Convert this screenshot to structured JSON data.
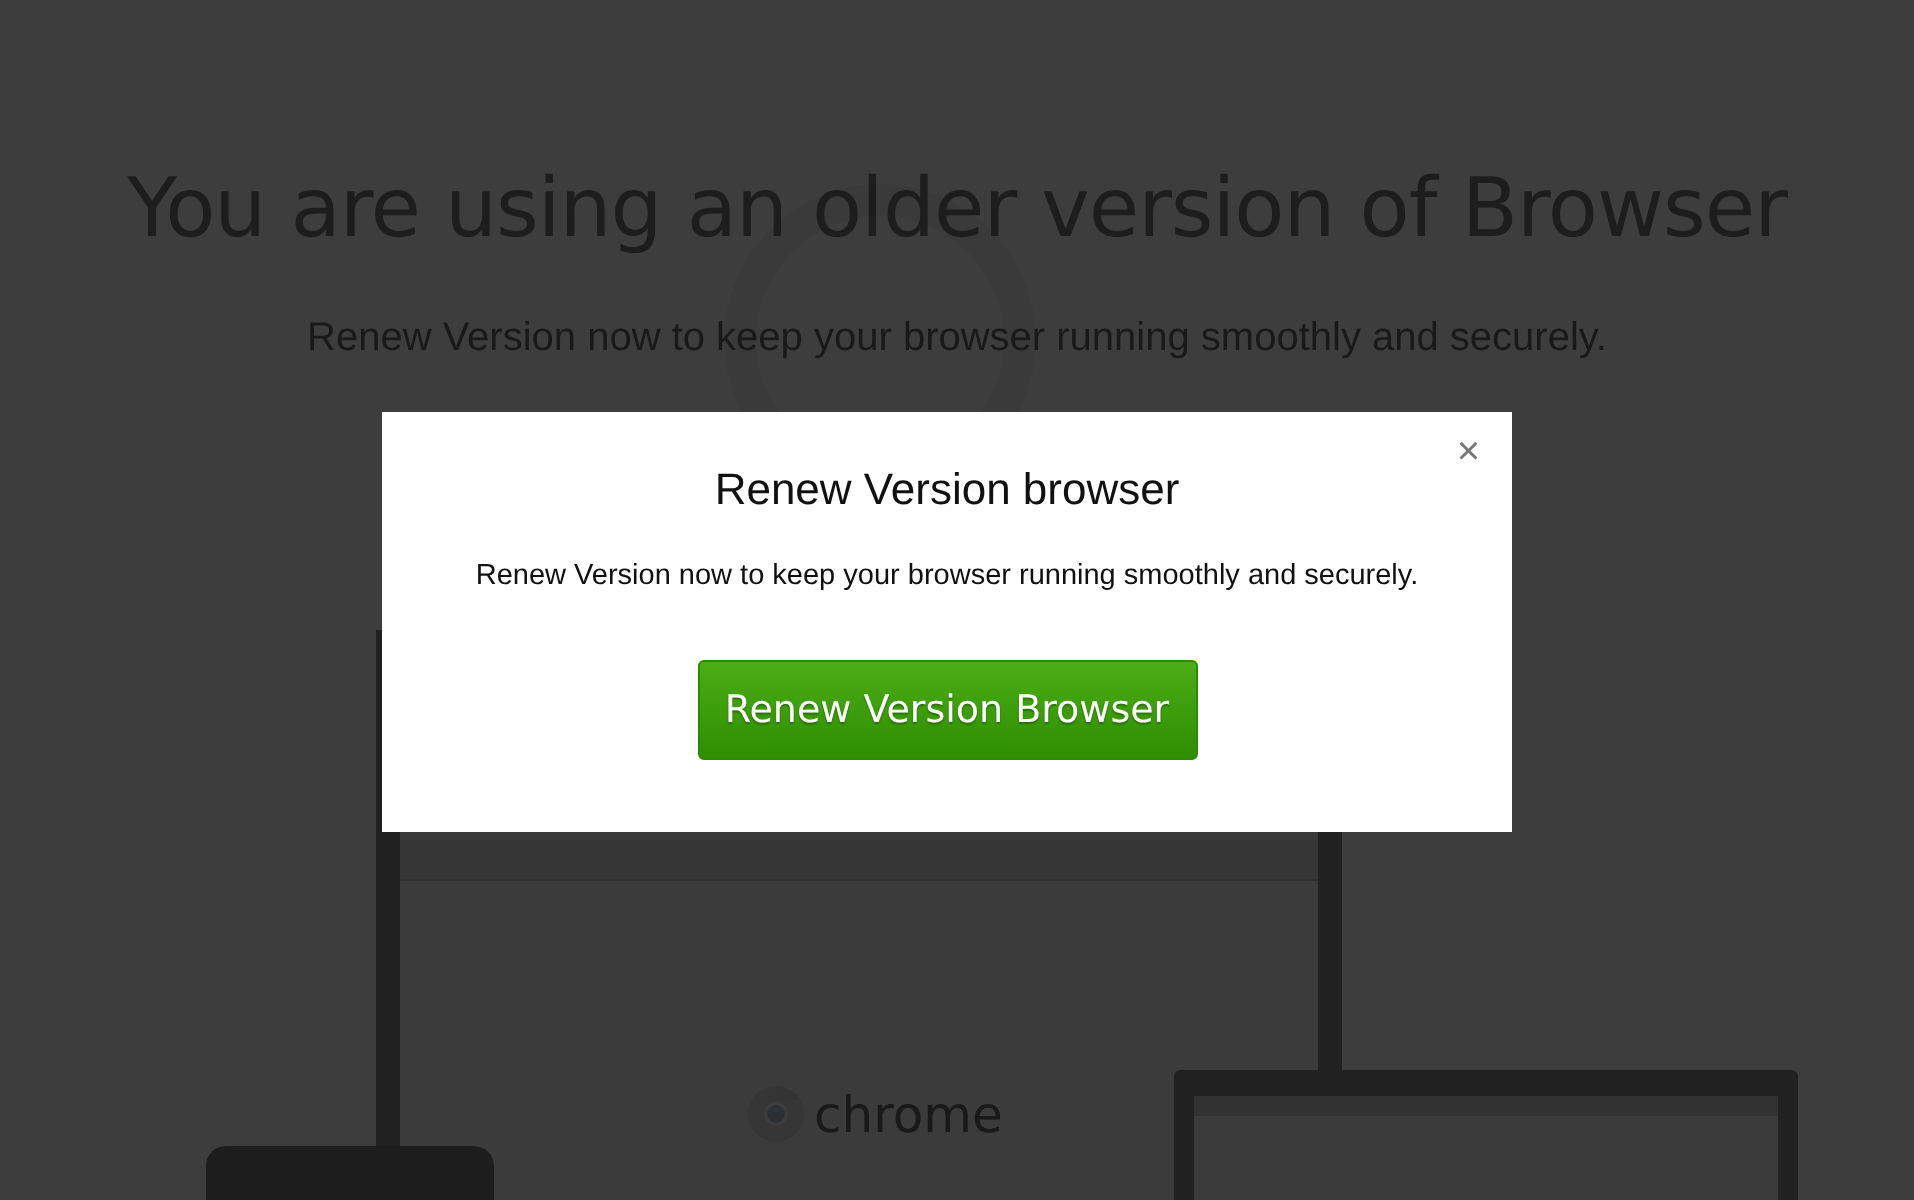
{
  "page": {
    "heading": "You are using an older version of Browser",
    "subtitle": "Renew Version now to keep your browser running smoothly and securely.",
    "illustration_label": "chrome"
  },
  "modal": {
    "title": "Renew Version browser",
    "close": "×",
    "message": "Renew Version now to keep your browser running smoothly and securely.",
    "button": "Renew Version Browser"
  }
}
